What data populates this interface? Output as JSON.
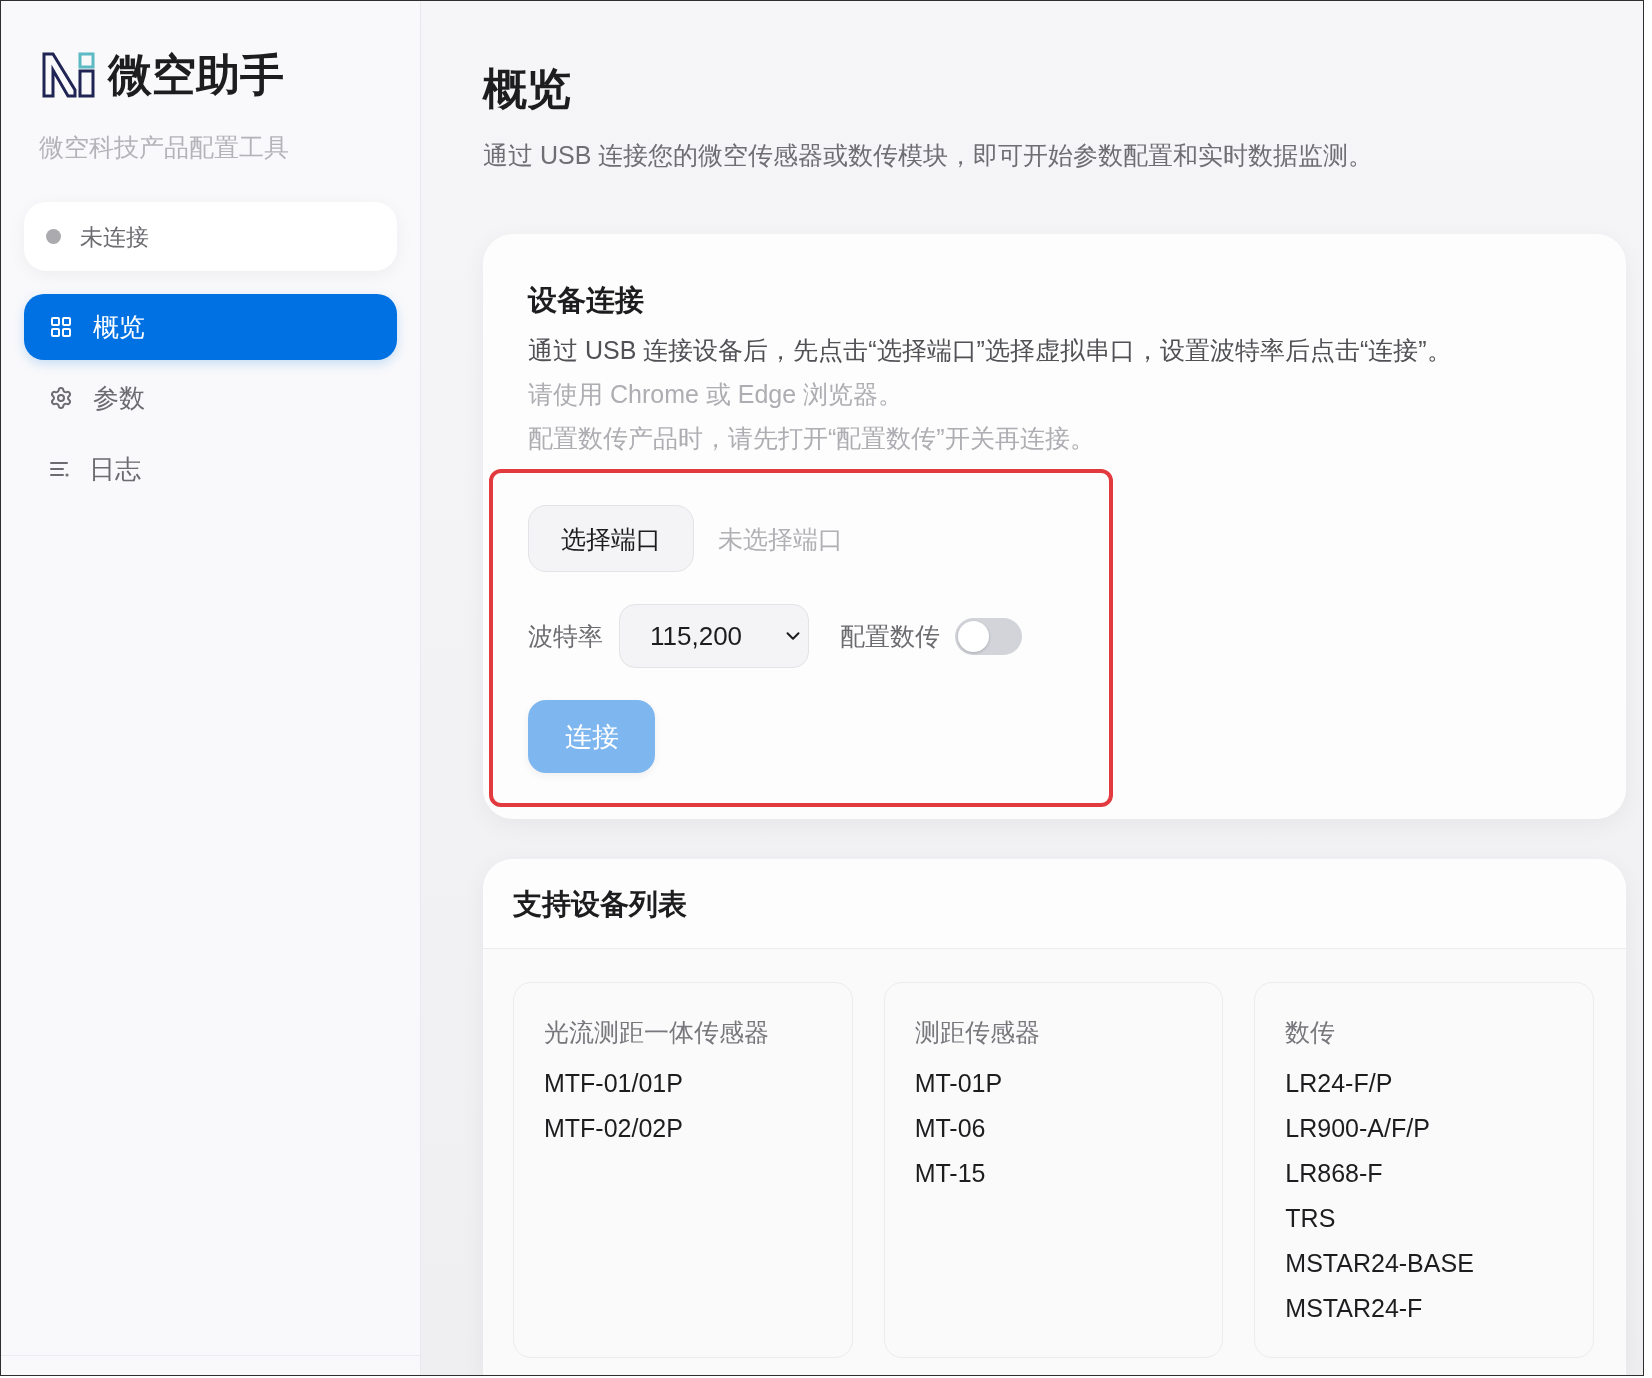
{
  "sidebar": {
    "brand": {
      "title": "微空助手",
      "subtitle": "微空科技产品配置工具"
    },
    "status": {
      "label": "未连接",
      "connected": false
    },
    "nav": [
      {
        "label": "概览",
        "selected": true
      },
      {
        "label": "参数",
        "selected": false
      },
      {
        "label": "日志",
        "selected": false
      }
    ]
  },
  "page": {
    "title": "概览",
    "description": "通过 USB 连接您的微空传感器或数传模块，即可开始参数配置和实时数据监测。"
  },
  "connection_card": {
    "title": "设备连接",
    "notes": [
      {
        "text": "通过 USB 连接设备后，先点击“选择端口”选择虚拟串口，设置波特率后点击“连接”。",
        "kind": "primary"
      },
      {
        "text": "请使用 Chrome 或 Edge 浏览器。",
        "kind": "muted"
      },
      {
        "text": "配置数传产品时，请先打开“配置数传”开关再连接。",
        "kind": "muted"
      }
    ],
    "highlighted": true,
    "port_button": "选择端口",
    "port_status": "未选择端口",
    "baud_label": "波特率",
    "baud_select": {
      "value": "115,200"
    },
    "telemetry_label": "配置数传",
    "telemetry_switch": {
      "on": false
    },
    "connect_button": {
      "label": "连接",
      "disabled": true
    }
  },
  "devices_card": {
    "title": "支持设备列表",
    "groups": [
      {
        "title": "光流测距一体传感器",
        "items": [
          "MTF-01/01P",
          "MTF-02/02P"
        ]
      },
      {
        "title": "测距传感器",
        "items": [
          "MT-01P",
          "MT-06",
          "MT-15"
        ]
      },
      {
        "title": "数传",
        "items": [
          "LR24-F/P",
          "LR900-A/F/P",
          "LR868-F",
          "TRS",
          "MSTAR24-BASE",
          "MSTAR24-F"
        ]
      }
    ]
  }
}
